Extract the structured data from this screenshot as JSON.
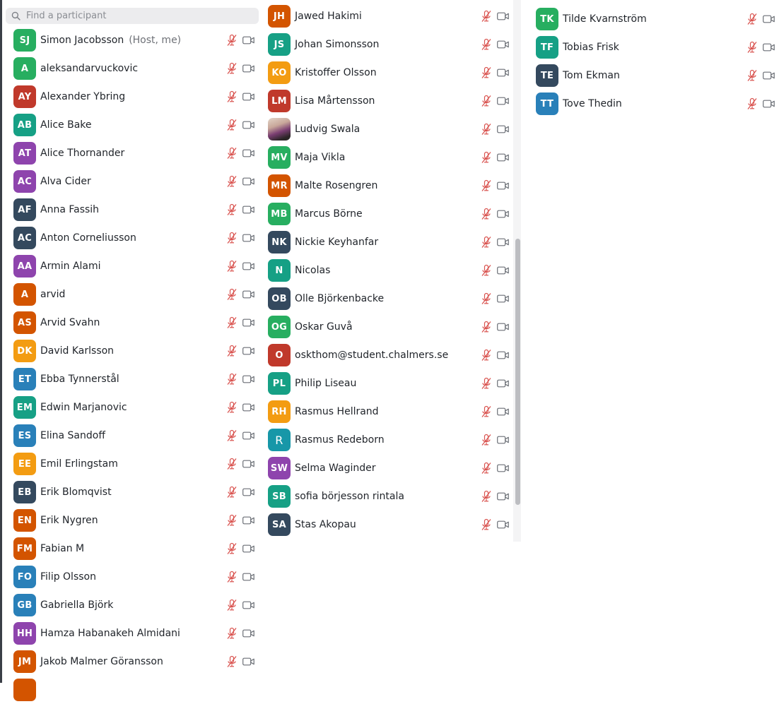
{
  "search": {
    "placeholder": "Find a participant"
  },
  "colors": {
    "mute_icon": "#d9534f",
    "video_icon": "#6b6f76",
    "page_bg": "#ffffff"
  },
  "columns": [
    [
      {
        "initials": "SJ",
        "name": "Simon Jacobsson",
        "role": "(Host, me)",
        "color": "#27ae60"
      },
      {
        "initials": "A",
        "name": "aleksandarvuckovic",
        "color": "#27ae60"
      },
      {
        "initials": "AY",
        "name": "Alexander Ybring",
        "color": "#c0392b"
      },
      {
        "initials": "AB",
        "name": "Alice Bake",
        "color": "#16a085"
      },
      {
        "initials": "AT",
        "name": "Alice Thornander",
        "color": "#8e44ad"
      },
      {
        "initials": "AC",
        "name": "Alva Cider",
        "color": "#8e44ad"
      },
      {
        "initials": "AF",
        "name": "Anna Fassih",
        "color": "#34495e"
      },
      {
        "initials": "AC",
        "name": "Anton Corneliusson",
        "color": "#34495e"
      },
      {
        "initials": "AA",
        "name": "Armin Alami",
        "color": "#8e44ad"
      },
      {
        "initials": "A",
        "name": "arvid",
        "color": "#d35400"
      },
      {
        "initials": "AS",
        "name": "Arvid Svahn",
        "color": "#d35400"
      },
      {
        "initials": "DK",
        "name": "David Karlsson",
        "color": "#f39c12"
      },
      {
        "initials": "ET",
        "name": "Ebba Tynnerstål",
        "color": "#2980b9"
      },
      {
        "initials": "EM",
        "name": "Edwin Marjanovic",
        "color": "#16a085"
      },
      {
        "initials": "ES",
        "name": "Elina Sandoff",
        "color": "#2980b9"
      },
      {
        "initials": "EE",
        "name": "Emil Erlingstam",
        "color": "#f39c12"
      },
      {
        "initials": "EB",
        "name": "Erik Blomqvist",
        "color": "#34495e"
      },
      {
        "initials": "EN",
        "name": "Erik Nygren",
        "color": "#d35400"
      },
      {
        "initials": "FM",
        "name": "Fabian M",
        "color": "#d35400"
      },
      {
        "initials": "FO",
        "name": "Filip Olsson",
        "color": "#2980b9"
      },
      {
        "initials": "GB",
        "name": "Gabriella Björk",
        "color": "#2980b9"
      },
      {
        "initials": "HH",
        "name": "Hamza Habanakeh Almidani",
        "color": "#8e44ad"
      },
      {
        "initials": "JM",
        "name": "Jakob Malmer Göransson",
        "color": "#d35400"
      },
      {
        "initials": "",
        "name": "",
        "color": "#d35400"
      }
    ],
    [
      {
        "initials": "JH",
        "name": "Jawed Hakimi",
        "color": "#d35400"
      },
      {
        "initials": "JS",
        "name": "Johan Simonsson",
        "color": "#16a085"
      },
      {
        "initials": "KO",
        "name": "Kristoffer Olsson",
        "color": "#f39c12"
      },
      {
        "initials": "LM",
        "name": "Lisa Mårtensson",
        "color": "#c0392b"
      },
      {
        "initials": "",
        "name": "Ludvig Swala",
        "color": "#7a3e72",
        "photo": true
      },
      {
        "initials": "MV",
        "name": "Maja Vikla",
        "color": "#27ae60"
      },
      {
        "initials": "MR",
        "name": "Malte Rosengren",
        "color": "#d35400"
      },
      {
        "initials": "MB",
        "name": "Marcus Börne",
        "color": "#27ae60"
      },
      {
        "initials": "NK",
        "name": "Nickie Keyhanfar",
        "color": "#34495e"
      },
      {
        "initials": "N",
        "name": "Nicolas",
        "color": "#16a085"
      },
      {
        "initials": "OB",
        "name": "Olle Björkenbacke",
        "color": "#34495e"
      },
      {
        "initials": "OG",
        "name": "Oskar Guvå",
        "color": "#27ae60"
      },
      {
        "initials": "O",
        "name": "oskthom@student.chalmers.se",
        "color": "#c0392b"
      },
      {
        "initials": "PL",
        "name": "Philip Liseau",
        "color": "#16a085"
      },
      {
        "initials": "RH",
        "name": "Rasmus Hellrand",
        "color": "#f39c12"
      },
      {
        "initials": "R",
        "name": "Rasmus Redeborn",
        "color": "#1797a8",
        "thin": true
      },
      {
        "initials": "SW",
        "name": "Selma Waginder",
        "color": "#8e44ad"
      },
      {
        "initials": "SB",
        "name": "sofia börjesson rintala",
        "color": "#16a085"
      },
      {
        "initials": "SA",
        "name": "Stas Akopau",
        "color": "#34495e"
      }
    ],
    [
      {
        "initials": "TK",
        "name": "Tilde Kvarnström",
        "color": "#27ae60"
      },
      {
        "initials": "TF",
        "name": "Tobias Frisk",
        "color": "#16a085"
      },
      {
        "initials": "TE",
        "name": "Tom Ekman",
        "color": "#34495e"
      },
      {
        "initials": "TT",
        "name": "Tove Thedin",
        "color": "#2980b9"
      }
    ]
  ]
}
